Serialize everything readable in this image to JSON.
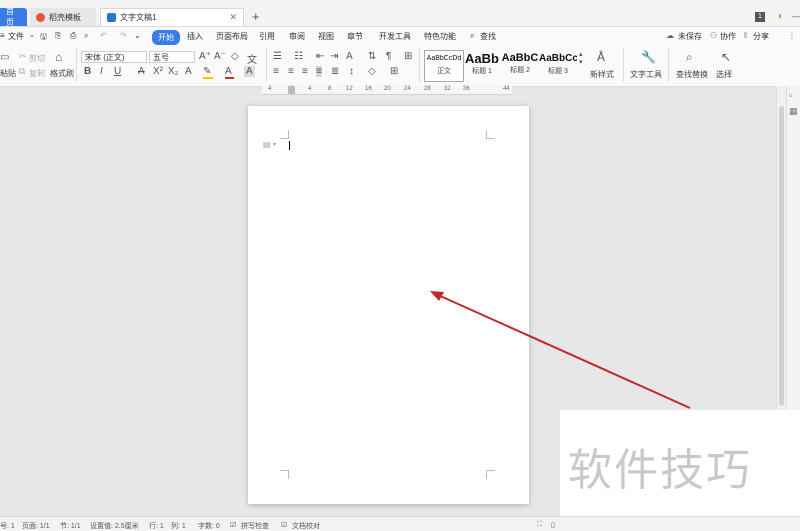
{
  "tabs": {
    "home": "首页",
    "templates": "稻壳模板",
    "document": "文字文稿1",
    "counter": "1"
  },
  "menu": {
    "file": "文件",
    "items": [
      "开始",
      "插入",
      "页面布局",
      "引用",
      "审阅",
      "视图",
      "章节",
      "开发工具",
      "特色功能"
    ],
    "search": "查找",
    "unsaved": "未保存",
    "collaborate": "协作",
    "share": "分享"
  },
  "ribbon": {
    "cut": "剪切",
    "copy": "复制",
    "paste": "粘贴",
    "format_painter": "格式刷",
    "font_name": "宋体 (正文)",
    "font_size": "五号",
    "styles": [
      {
        "preview": "AaBbCcDd",
        "name": "正文"
      },
      {
        "preview": "AaBb",
        "name": "标题 1"
      },
      {
        "preview": "AaBbC",
        "name": "标题 2"
      },
      {
        "preview": "AaBbCc",
        "name": "标题 3"
      }
    ],
    "new_style": "新样式",
    "text_tools": "文字工具",
    "find_replace": "查找替换",
    "select": "选择"
  },
  "ruler": {
    "ticks": [
      "4",
      "2",
      "4",
      "8",
      "12",
      "16",
      "20",
      "24",
      "28",
      "32",
      "36",
      "44"
    ]
  },
  "status": {
    "section_no": "号: 1",
    "page": "页面: 1/1",
    "section": "节: 1/1",
    "setting": "设置值: 2.5厘米",
    "row": "行: 1",
    "col": "列: 1",
    "words": "字数: 0",
    "spell_check": "拼写检查",
    "proofread": "文档校对"
  },
  "watermark": "软件技巧",
  "colors": {
    "accent": "#3a7be8",
    "arrow": "#c0282a",
    "highlight": "#f5c400",
    "font_color": "#d03030"
  }
}
